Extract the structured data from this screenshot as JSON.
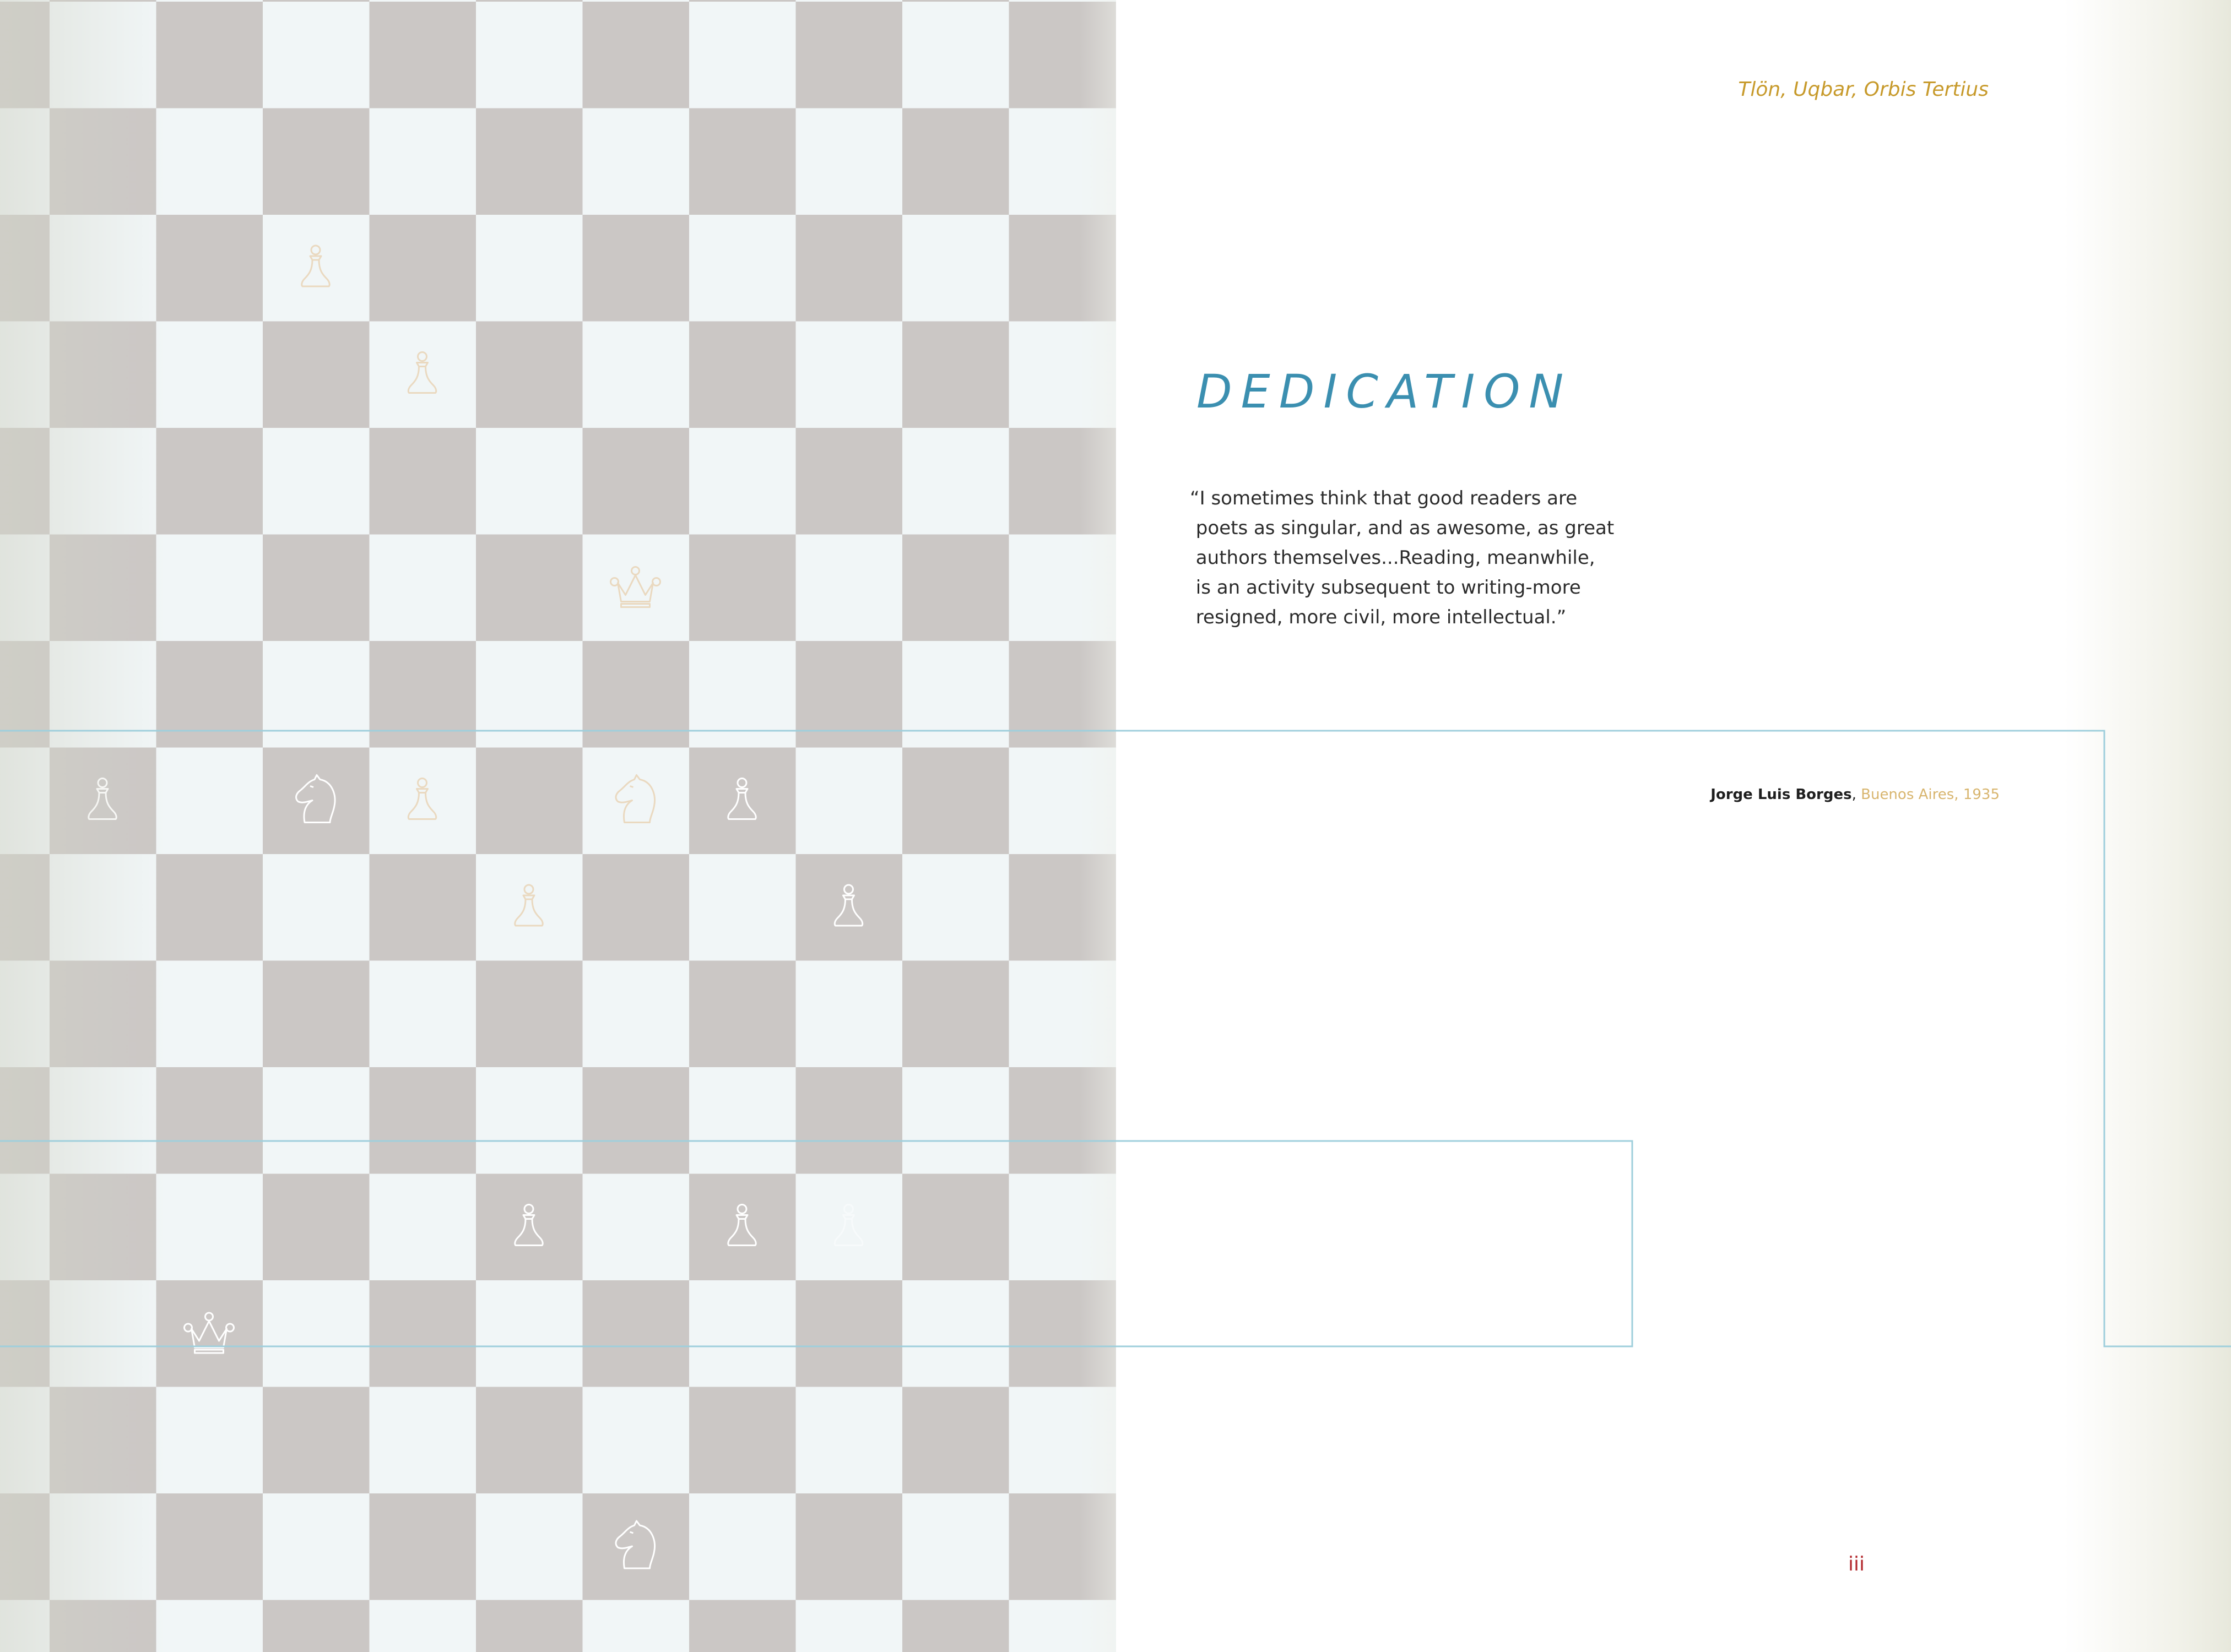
{
  "running_title": "Tlön, Uqbar, Orbis Tertius",
  "heading": "DEDICATION",
  "quote": "“I sometimes think that good readers are\n poets as singular, and as awesome, as great\n authors themselves...Reading, meanwhile,\n is an activity subsequent to writing-more\n resigned, more civil, more intellectual.”",
  "attribution": {
    "author": "Jorge Luis Borges",
    "separator": ", ",
    "place_year": "Buenos Aires, 1935"
  },
  "folio": "iii",
  "colors": {
    "dark_square": "#cbc7c5",
    "light_square": "#f1f6f7",
    "heading": "#3b8fb0",
    "accent_gold": "#c79a2b",
    "folio": "#b3282d",
    "guide_line": "#9fcfdc"
  },
  "board": {
    "pieces": [
      {
        "type": "pawn",
        "col": 2,
        "row": 2,
        "style": "faint-gold"
      },
      {
        "type": "pawn",
        "col": 3,
        "row": 3,
        "style": "faint-gold"
      },
      {
        "type": "queen",
        "col": 5,
        "row": 5,
        "style": "faint-gold"
      },
      {
        "type": "pawn",
        "col": 0,
        "row": 7,
        "style": "white"
      },
      {
        "type": "knight",
        "col": 2,
        "row": 7,
        "style": "white"
      },
      {
        "type": "pawn",
        "col": 3,
        "row": 7,
        "style": "faint-gold"
      },
      {
        "type": "knight",
        "col": 5,
        "row": 7,
        "style": "faint-gold"
      },
      {
        "type": "pawn",
        "col": 6,
        "row": 7,
        "style": "white"
      },
      {
        "type": "pawn",
        "col": 4,
        "row": 8,
        "style": "faint-gold"
      },
      {
        "type": "pawn",
        "col": 7,
        "row": 8,
        "style": "white"
      },
      {
        "type": "pawn",
        "col": 4,
        "row": 11,
        "style": "white"
      },
      {
        "type": "pawn",
        "col": 6,
        "row": 11,
        "style": "white"
      },
      {
        "type": "pawn",
        "col": 7,
        "row": 11,
        "style": "faint-white"
      },
      {
        "type": "queen",
        "col": 1,
        "row": 12,
        "style": "white"
      },
      {
        "type": "knight",
        "col": 5,
        "row": 14,
        "style": "white"
      }
    ]
  }
}
